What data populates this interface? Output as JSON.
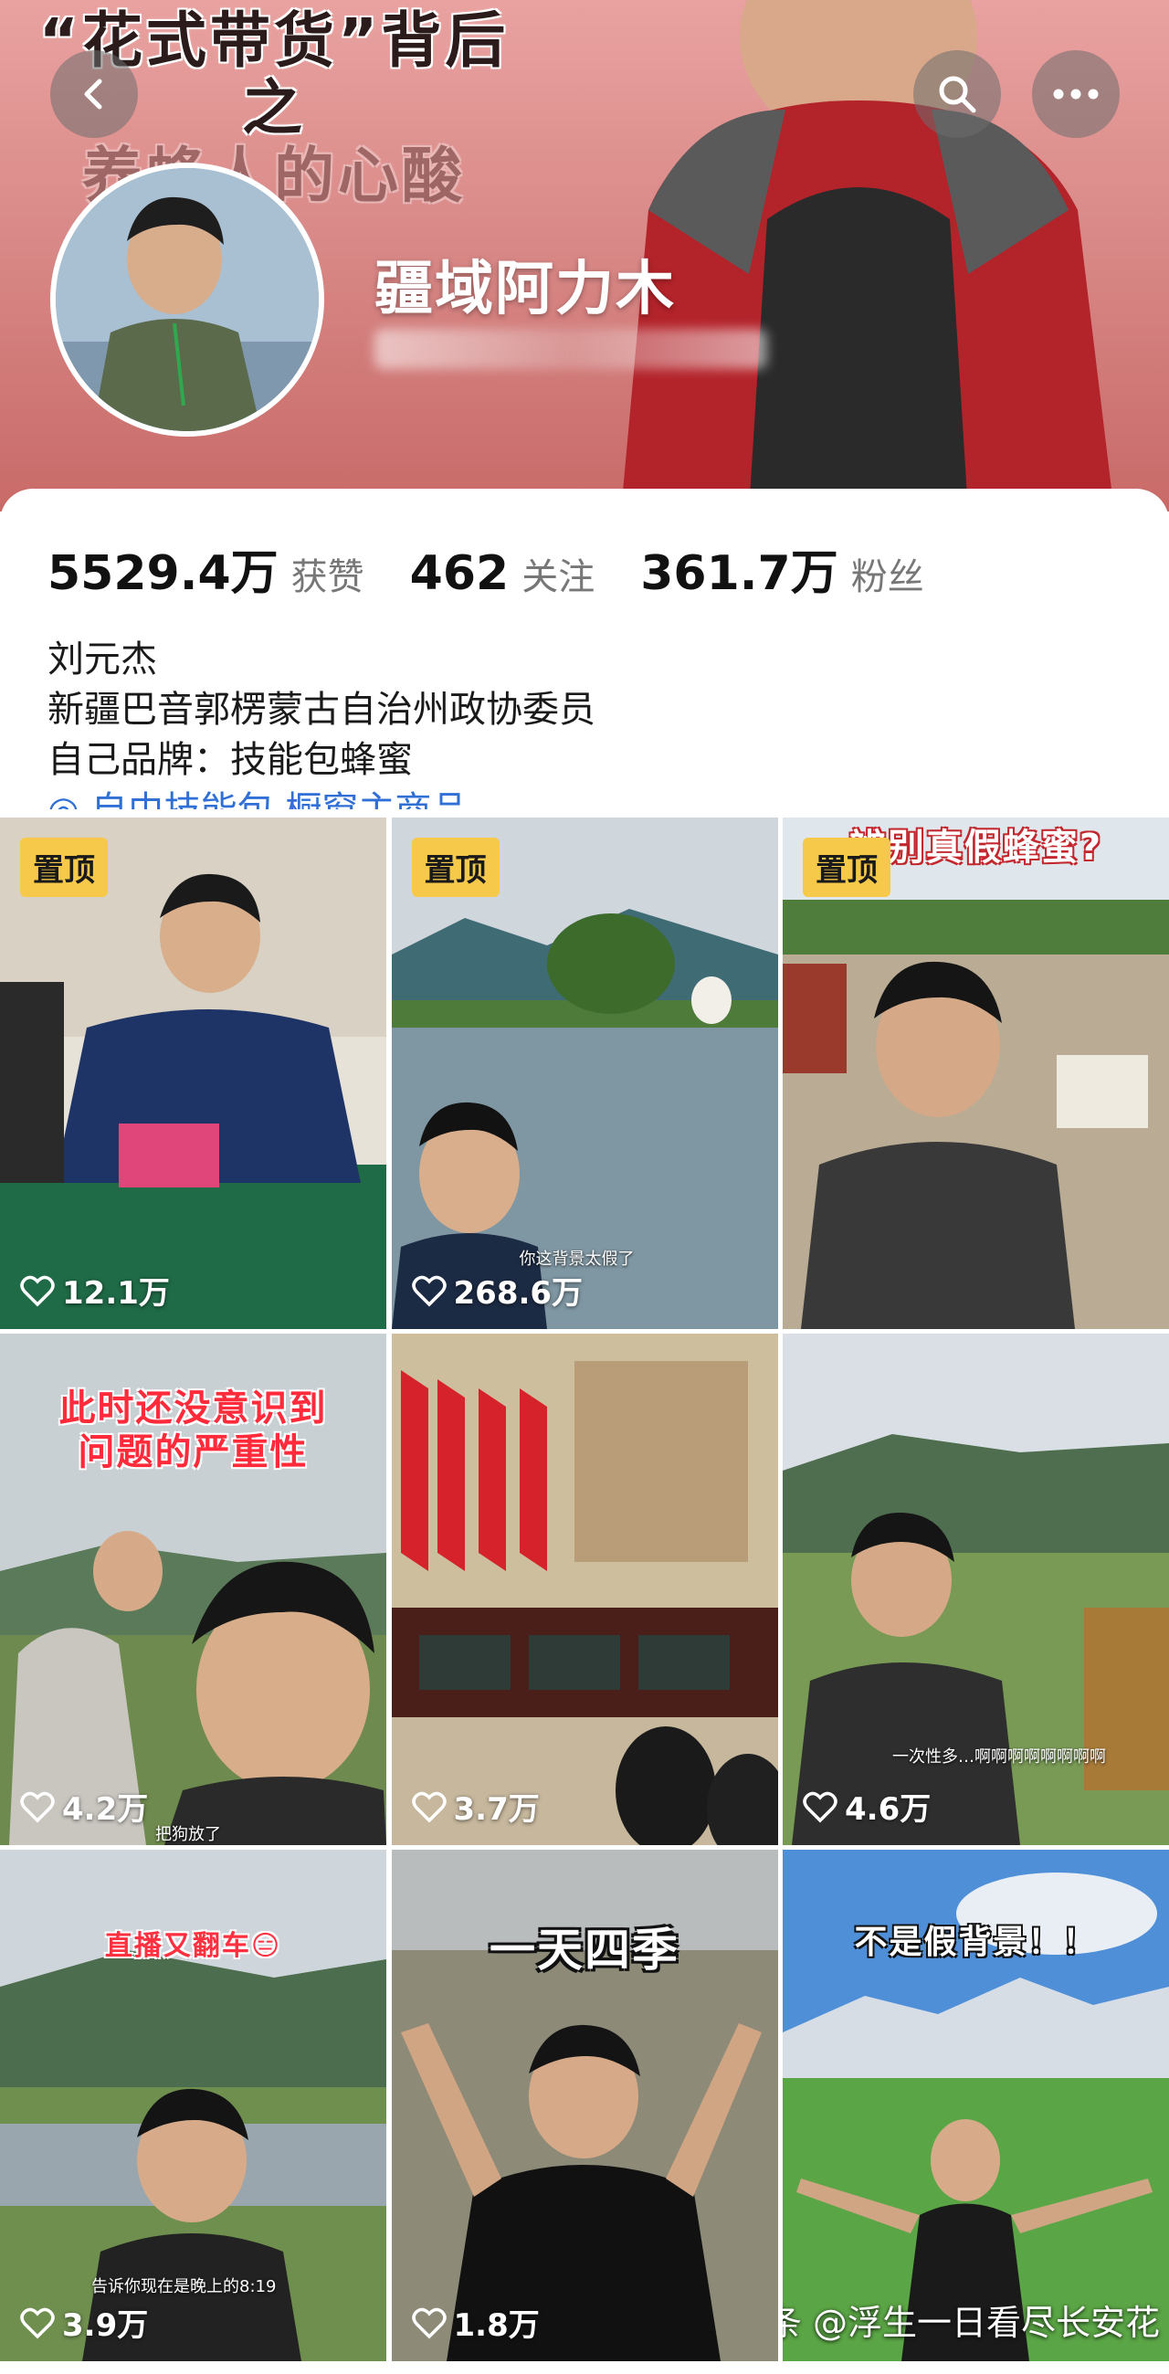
{
  "banner": {
    "title_line1": "“花式带货”背后",
    "title_line2": "之",
    "title_line3": "养蜂人的心酸",
    "display_name": "疆域阿力木"
  },
  "stats": [
    {
      "num": "5529.4万",
      "label": "获赞"
    },
    {
      "num": "462",
      "label": "关注"
    },
    {
      "num": "361.7万",
      "label": "粉丝"
    }
  ],
  "bio": {
    "line1": "刘元杰",
    "line2": "新疆巴音郭楞蒙古自治州政协委员",
    "line3": "自己品牌：技能包蜂蜜",
    "line4": "◎ 自由技能包 橱窗主商品"
  },
  "videos": [
    {
      "pinned": "置顶",
      "likes": "12.1万"
    },
    {
      "pinned": "置顶",
      "likes": "268.6万",
      "subtitle": "你这背景太假了"
    },
    {
      "pinned": "置顶",
      "likes": "",
      "title": "辨别真假蜂蜜?"
    },
    {
      "likes": "4.2万",
      "title_line1": "此时还没意识到",
      "title_line2": "问题的严重性",
      "subtitle": "把狗放了"
    },
    {
      "likes": "3.7万"
    },
    {
      "likes": "4.6万",
      "subtitle": "一次性多…啊啊啊啊啊啊啊啊"
    },
    {
      "likes": "3.9万",
      "title": "直播又翻车😑",
      "subtitle": "告诉你现在是晚上的8:19"
    },
    {
      "likes": "1.8万",
      "title": "一天四季"
    },
    {
      "likes": "",
      "title": "不是假背景！！"
    }
  ],
  "watermark": "头条 @浮生一日看尽长安花"
}
